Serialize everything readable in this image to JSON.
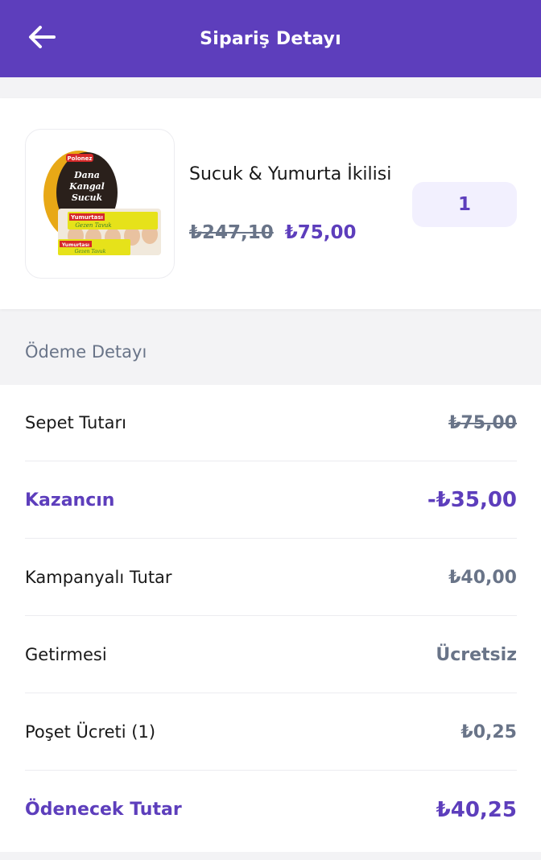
{
  "header": {
    "title": "Sipariş Detayı",
    "back_icon": "arrow-left-icon"
  },
  "product": {
    "name": "Sucuk & Yumurta İkilisi",
    "old_price": "₺247,10",
    "new_price": "₺75,00",
    "quantity": "1",
    "image_labels": {
      "brand": "Polonez",
      "sucuk_text": "Dana Kangal Sucuk",
      "egg_brand": "Yumurtası",
      "egg_sub": "Gezen Tavuk"
    }
  },
  "payment": {
    "section_title": "Ödeme Detayı",
    "rows": [
      {
        "label": "Sepet Tutarı",
        "value": "₺75,00"
      },
      {
        "label": "Kazancın",
        "value": "-₺35,00"
      },
      {
        "label": "Kampanyalı Tutar",
        "value": "₺40,00"
      },
      {
        "label": "Getirmesi",
        "value": "Ücretsiz"
      },
      {
        "label": "Poşet Ücreti (1)",
        "value": "₺0,25"
      },
      {
        "label": "Ödenecek Tutar",
        "value": "₺40,25"
      }
    ]
  },
  "colors": {
    "brand_purple": "#5d3ebc",
    "muted_gray": "#697488",
    "qty_bg": "#f2f0fe"
  }
}
